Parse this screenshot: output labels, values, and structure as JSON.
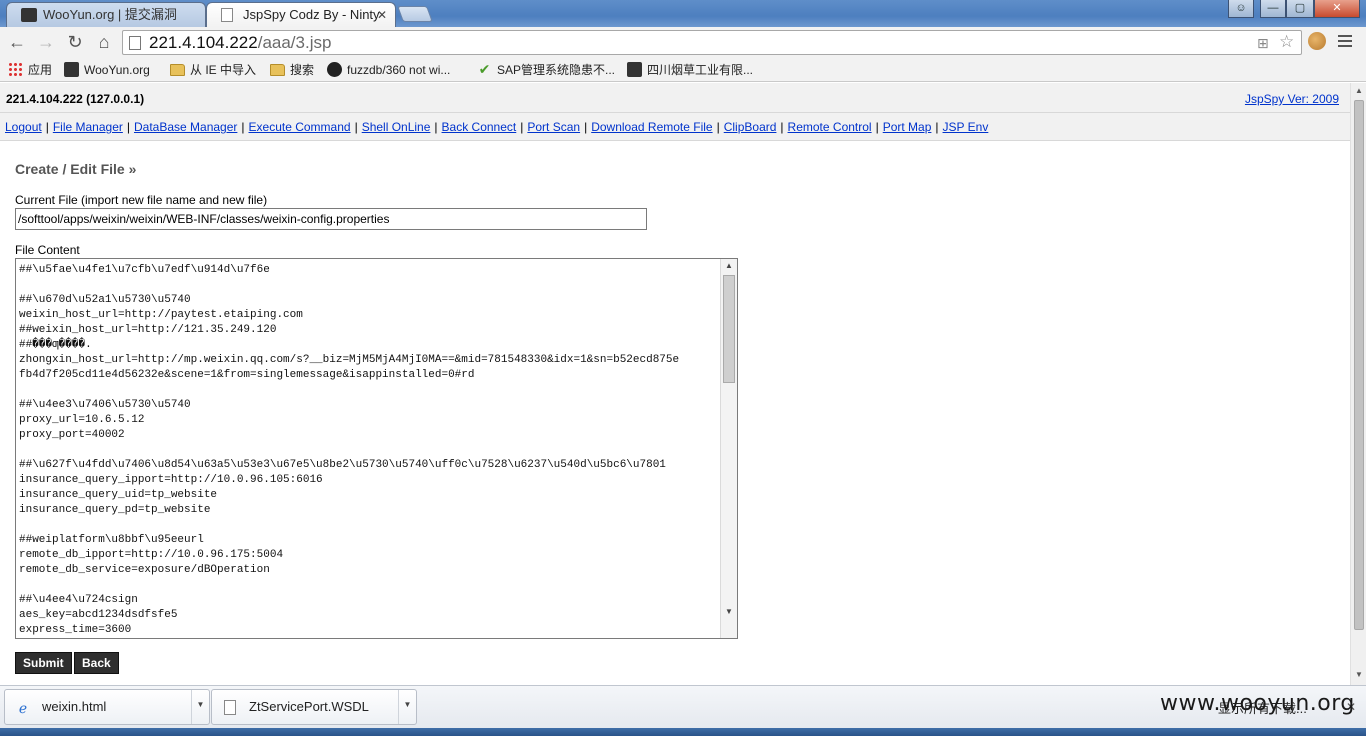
{
  "browser": {
    "tabs": [
      {
        "title": "WooYun.org | 提交漏洞"
      },
      {
        "title": "JspSpy Codz By - Ninty"
      }
    ],
    "url_host": "221.4.104.222",
    "url_path": "/aaa/3.jsp",
    "bookmarks": [
      {
        "label": "应用",
        "icon": "apps-icon"
      },
      {
        "label": "WooYun.org",
        "icon": "wooyun-icon"
      },
      {
        "label": "从 IE 中导入",
        "icon": "folder-icon"
      },
      {
        "label": "搜索",
        "icon": "folder-icon"
      },
      {
        "label": "fuzzdb/360 not wi...",
        "icon": "github-icon"
      },
      {
        "label": "SAP管理系统隐患不...",
        "icon": "check-icon"
      },
      {
        "label": "四川烟草工业有限...",
        "icon": "wooyun-icon"
      }
    ]
  },
  "page": {
    "host": "221.4.104.222 (127.0.0.1)",
    "version_link": "JspSpy Ver: 2009",
    "menu": [
      "Logout",
      "File Manager",
      "DataBase Manager",
      "Execute Command",
      "Shell OnLine",
      "Back Connect",
      "Port Scan",
      "Download Remote File",
      "ClipBoard",
      "Remote Control",
      "Port Map",
      "JSP Env"
    ],
    "section_title": "Create / Edit File »",
    "current_file_label": "Current File (import new file name and new file)",
    "current_file_value": "/softtool/apps/weixin/weixin/WEB-INF/classes/weixin-config.properties",
    "file_content_label": "File Content",
    "file_content": "##\\u5fae\\u4fe1\\u7cfb\\u7edf\\u914d\\u7f6e\n\n##\\u670d\\u52a1\\u5730\\u5740\nweixin_host_url=http://paytest.etaiping.com\n##weixin_host_url=http://121.35.249.120\n##���ƣ����.\nzhongxin_host_url=http://mp.weixin.qq.com/s?__biz=MjM5MjA4MjI0MA==&mid=781548330&idx=1&sn=b52ecd875e\nfb4d7f205cd11e4d56232e&scene=1&from=singlemessage&isappinstalled=0#rd\n\n##\\u4ee3\\u7406\\u5730\\u5740\nproxy_url=10.6.5.12\nproxy_port=40002\n\n##\\u627f\\u4fdd\\u7406\\u8d54\\u63a5\\u53e3\\u67e5\\u8be2\\u5730\\u5740\\uff0c\\u7528\\u6237\\u540d\\u5bc6\\u7801\ninsurance_query_ipport=http://10.0.96.105:6016\ninsurance_query_uid=tp_website\ninsurance_query_pd=tp_website\n\n##weiplatform\\u8bbf\\u95eeurl\nremote_db_ipport=http://10.0.96.175:5004\nremote_db_service=exposure/dBOperation\n\n##\\u4ee4\\u724csign\naes_key=abcd1234dsdfsfe5\nexpress_time=3600",
    "submit_label": "Submit",
    "back_label": "Back"
  },
  "downloads": {
    "items": [
      {
        "name": "weixin.html",
        "icon": "ie-file-icon"
      },
      {
        "name": "ZtServicePort.WSDL",
        "icon": "file-icon"
      }
    ],
    "show_all": "显示所有下载..."
  },
  "watermark": "www.wooyun.org",
  "colors": {
    "link": "#0033cc",
    "button_bg": "#2f2f2f",
    "tabstrip": "#5f8ec9"
  }
}
